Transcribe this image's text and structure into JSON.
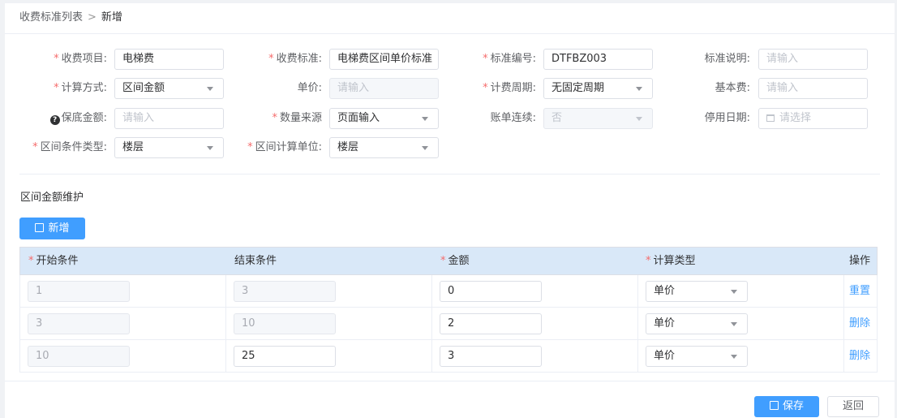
{
  "breadcrumb": {
    "parent": "收费标准列表",
    "separator": ">",
    "current": "新增"
  },
  "form": {
    "fee_item": {
      "label": "收费项目:",
      "value": "电梯费",
      "required": "*"
    },
    "fee_standard": {
      "label": "收费标准:",
      "value": "电梯费区间单价标准",
      "required": "*"
    },
    "standard_code": {
      "label": "标准编号:",
      "value": "DTFBZ003",
      "required": "*"
    },
    "standard_desc": {
      "label": "标准说明:",
      "placeholder": "请输入"
    },
    "calc_method": {
      "label": "计算方式:",
      "value": "区间金额",
      "required": "*"
    },
    "unit_price": {
      "label": "单价:",
      "placeholder": "请输入"
    },
    "billing_cycle": {
      "label": "计费周期:",
      "value": "无固定周期",
      "required": "*"
    },
    "base_fee": {
      "label": "基本费:",
      "placeholder": "请输入"
    },
    "min_amount": {
      "label": "保底金额:",
      "placeholder": "请输入",
      "help_icon": "?"
    },
    "qty_source": {
      "label": "数量来源",
      "value": "页面输入",
      "required": "*"
    },
    "bill_continuous": {
      "label": "账单连续:",
      "value": "否"
    },
    "stop_date": {
      "label": "停用日期:",
      "placeholder": "请选择"
    },
    "interval_cond_type": {
      "label": "区间条件类型:",
      "value": "楼层",
      "required": "*"
    },
    "interval_calc_unit": {
      "label": "区间计算单位:",
      "value": "楼层",
      "required": "*"
    }
  },
  "section": {
    "title": "区间金额维护",
    "add_label": "新增"
  },
  "table": {
    "required_mark": "*",
    "headers": {
      "start": "开始条件",
      "end": "结束条件",
      "amount": "金额",
      "calc_type": "计算类型",
      "op": "操作"
    },
    "rows": [
      {
        "start": "1",
        "end": "3",
        "amount": "0",
        "calc_type": "单价",
        "op": "重置"
      },
      {
        "start": "3",
        "end": "10",
        "amount": "2",
        "calc_type": "单价",
        "op": "删除"
      },
      {
        "start": "10",
        "end": "25",
        "amount": "3",
        "calc_type": "单价",
        "op": "删除"
      }
    ]
  },
  "footer": {
    "save_label": "保存",
    "back_label": "返回"
  },
  "colors": {
    "primary": "#409eff",
    "required": "#f56c6c",
    "header_bg": "#d9e8f8"
  }
}
